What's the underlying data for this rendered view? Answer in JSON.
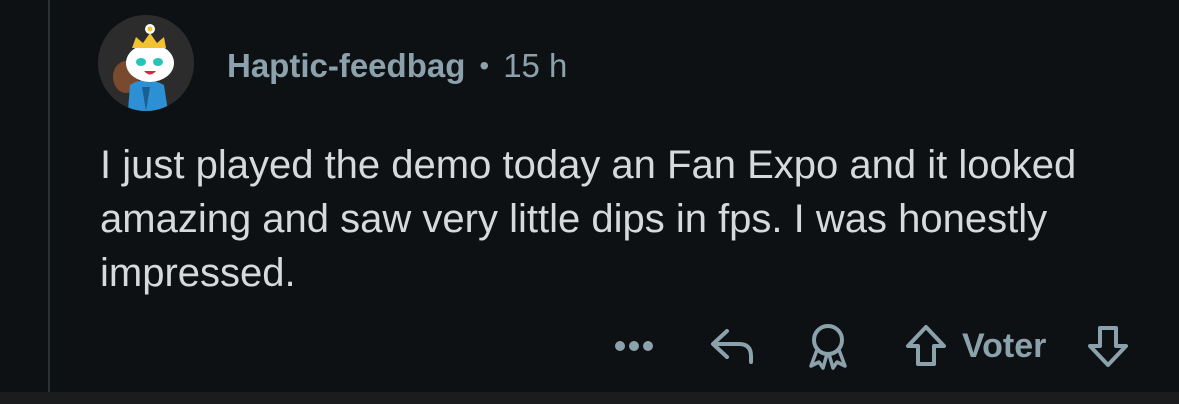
{
  "comment": {
    "username": "Haptic-feedbag",
    "separator": "•",
    "timestamp": "15 h",
    "body": "I just played the demo today an Fan Expo and it looked amazing and saw very little dips in fps. I was honestly impressed."
  },
  "actions": {
    "more_icon": "ellipsis-icon",
    "reply_icon": "reply-arrow-icon",
    "award_icon": "award-icon",
    "upvote_icon": "upvote-arrow-icon",
    "vote_label": "Voter",
    "downvote_icon": "downvote-arrow-icon"
  },
  "colors": {
    "background": "#0e1113",
    "meta_text": "#8ba2ad",
    "body_text": "#d7dadc",
    "thread_line": "#2a3236"
  }
}
